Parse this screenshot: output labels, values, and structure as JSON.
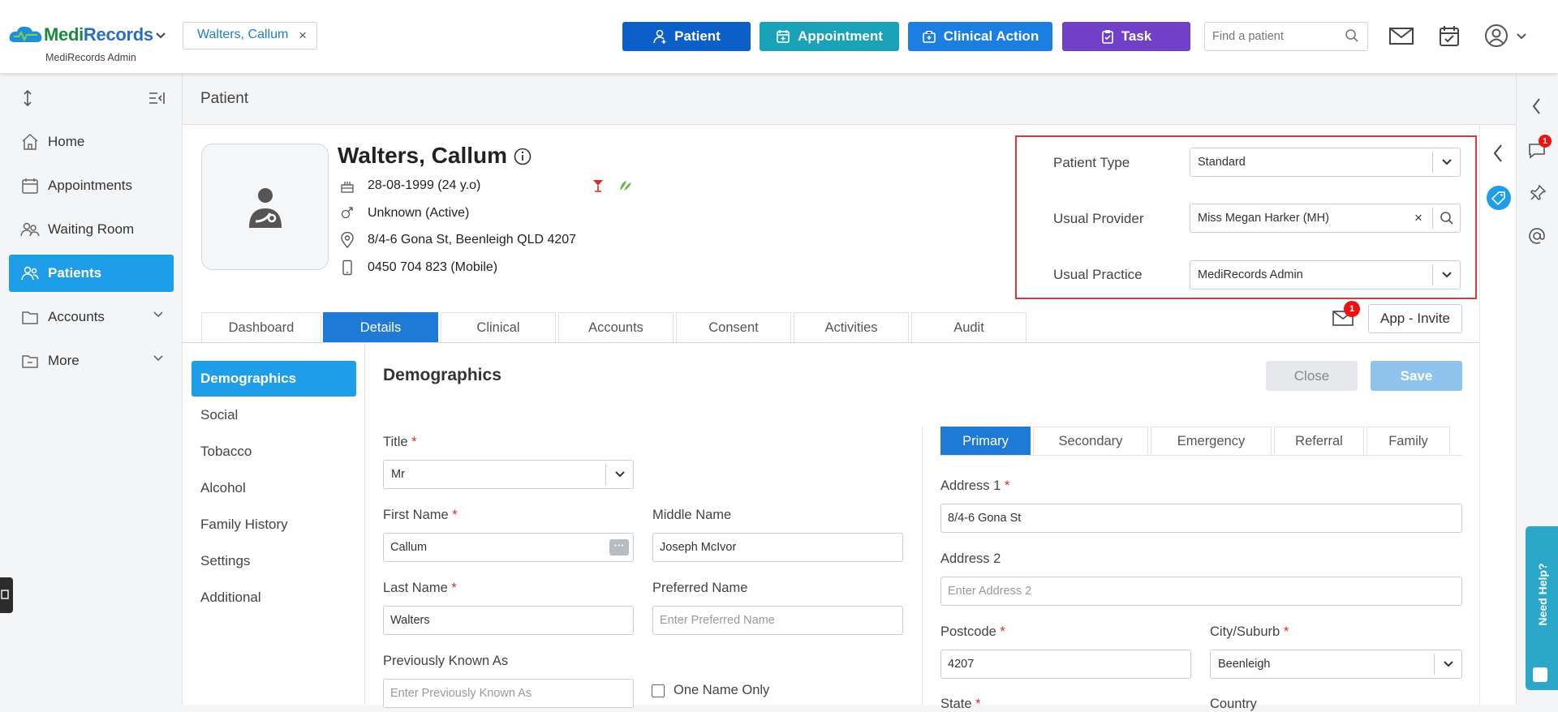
{
  "app": {
    "name_part1": "Medi",
    "name_part2": "Records",
    "org": "MediRecords Admin"
  },
  "open_patient_tab": {
    "label": "Walters, Callum"
  },
  "toolbar": {
    "patient_label": "Patient",
    "appointment_label": "Appointment",
    "clinical_action_label": "Clinical Action",
    "task_label": "Task",
    "search_placeholder": "Find a patient",
    "colors": {
      "patient": "#0c5ec8",
      "appointment": "#1aa3b8",
      "clinical_action": "#1a7fe0",
      "task": "#7040c8"
    }
  },
  "sidebar": {
    "items": [
      {
        "label": "Home",
        "icon": "home-icon"
      },
      {
        "label": "Appointments",
        "icon": "calendar-icon"
      },
      {
        "label": "Waiting Room",
        "icon": "people-icon"
      },
      {
        "label": "Patients",
        "icon": "patients-icon"
      },
      {
        "label": "Accounts",
        "icon": "folder-icon"
      },
      {
        "label": "More",
        "icon": "folder-icon"
      }
    ]
  },
  "page": {
    "title": "Patient"
  },
  "patient": {
    "name": "Walters, Callum",
    "dob": "28-08-1999 (24 y.o)",
    "gender": "Unknown (Active)",
    "address": "8/4-6 Gona St, Beenleigh QLD 4207",
    "phone": "0450 704 823 (Mobile)"
  },
  "patient_settings": {
    "type_label": "Patient Type",
    "type_value": "Standard",
    "provider_label": "Usual Provider",
    "provider_value": "Miss Megan Harker (MH)",
    "practice_label": "Usual Practice",
    "practice_value": "MediRecords Admin"
  },
  "tabs": [
    "Dashboard",
    "Details",
    "Clinical",
    "Accounts",
    "Consent",
    "Activities",
    "Audit"
  ],
  "active_tab": "Details",
  "messages_badge": "1",
  "app_invite_label": "App - Invite",
  "subnav": [
    "Demographics",
    "Social",
    "Tobacco",
    "Alcohol",
    "Family History",
    "Settings",
    "Additional"
  ],
  "section": {
    "title": "Demographics",
    "close_label": "Close",
    "save_label": "Save"
  },
  "form": {
    "title_label": "Title",
    "title_value": "Mr",
    "first_name_label": "First Name",
    "first_name_value": "Callum",
    "middle_name_label": "Middle Name",
    "middle_name_value": "Joseph McIvor",
    "last_name_label": "Last Name",
    "last_name_value": "Walters",
    "preferred_name_label": "Preferred Name",
    "preferred_name_placeholder": "Enter Preferred Name",
    "pka_label": "Previously Known As",
    "pka_placeholder": "Enter Previously Known As",
    "one_name_label": "One Name Only"
  },
  "contact_tabs": [
    "Primary",
    "Secondary",
    "Emergency",
    "Referral",
    "Family"
  ],
  "address_form": {
    "address1_label": "Address 1",
    "address1_value": "8/4-6 Gona St",
    "address2_label": "Address 2",
    "address2_placeholder": "Enter Address 2",
    "postcode_label": "Postcode",
    "postcode_value": "4207",
    "city_label": "City/Suburb",
    "city_value": "Beenleigh",
    "state_label": "State",
    "country_label": "Country"
  },
  "right_rail": {
    "chat_badge": "1"
  },
  "help": {
    "label": "Need Help?"
  }
}
